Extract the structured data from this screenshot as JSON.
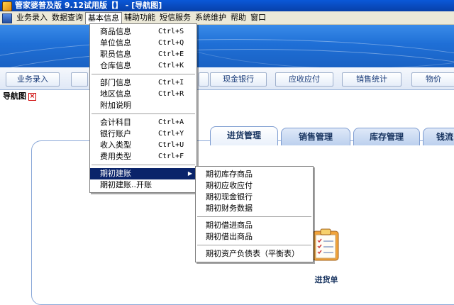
{
  "window": {
    "title": "管家婆普及版 9.12试用版【】 - [导航图]"
  },
  "menubar": {
    "items": [
      "业务录入",
      "数据查询",
      "基本信息",
      "辅助功能",
      "短信服务",
      "系统维护",
      "帮助",
      "窗口"
    ]
  },
  "quickbar": {
    "buttons": [
      "业务录入",
      "",
      "",
      "现金银行",
      "应收应付",
      "销售统计",
      "物价"
    ]
  },
  "nav_tab": {
    "label": "导航图"
  },
  "tabs": [
    "进货管理",
    "销售管理",
    "库存管理",
    "钱流"
  ],
  "doc": {
    "label": "进货单"
  },
  "basic_info_menu": {
    "items": [
      {
        "label": "商品信息",
        "shortcut": "Ctrl+S"
      },
      {
        "label": "单位信息",
        "shortcut": "Ctrl+Q"
      },
      {
        "label": "职员信息",
        "shortcut": "Ctrl+E"
      },
      {
        "label": "仓库信息",
        "shortcut": "Ctrl+K"
      },
      {
        "label": "部门信息",
        "shortcut": "Ctrl+I"
      },
      {
        "label": "地区信息",
        "shortcut": "Ctrl+R"
      },
      {
        "label": "附加说明",
        "shortcut": ""
      },
      {
        "label": "会计科目",
        "shortcut": "Ctrl+A"
      },
      {
        "label": "银行账户",
        "shortcut": "Ctrl+Y"
      },
      {
        "label": "收入类型",
        "shortcut": "Ctrl+U"
      },
      {
        "label": "费用类型",
        "shortcut": "Ctrl+F"
      },
      {
        "label": "期初建账",
        "shortcut": ""
      },
      {
        "label": "期初建账..开账",
        "shortcut": ""
      }
    ]
  },
  "opening_submenu": {
    "items": [
      "期初库存商品",
      "期初应收应付",
      "期初现金银行",
      "期初财务数据",
      "期初借进商品",
      "期初借出商品",
      "期初资产负债表（平衡表）"
    ]
  },
  "colors": {
    "highlight": "#0a246a",
    "titlebar": "#0a58d8",
    "banner": "#1f6fd6"
  },
  "icons": {
    "app": "app-icon",
    "close": "close-icon",
    "doc": "clipboard-doc-icon",
    "submenu": "submenu-arrow-icon"
  }
}
